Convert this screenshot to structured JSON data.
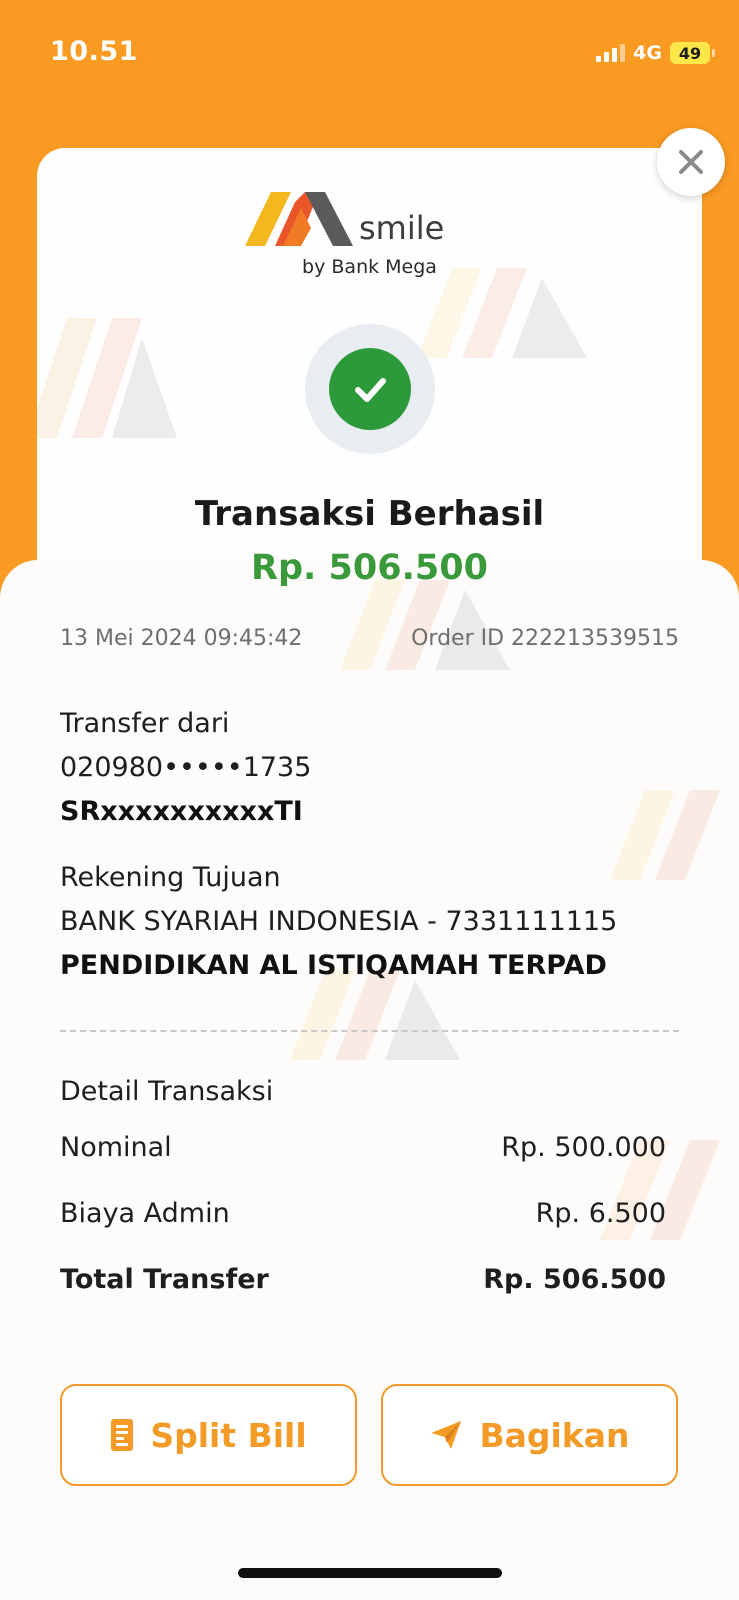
{
  "status_bar": {
    "time": "10.51",
    "network": "4G",
    "battery": "49"
  },
  "logo": {
    "name": "smile",
    "sub": "by Bank Mega"
  },
  "result": {
    "title": "Transaksi Berhasil",
    "amount": "Rp. 506.500"
  },
  "meta": {
    "date": "13 Mei 2024 09:45:42",
    "order_id": "Order ID 222213539515"
  },
  "source": {
    "label": "Transfer dari",
    "account": "020980•••••1735",
    "name": "SRxxxxxxxxxxTI"
  },
  "destination": {
    "label": "Rekening Tujuan",
    "bank_account": "BANK SYARIAH INDONESIA - 7331111115",
    "name": "PENDIDIKAN AL ISTIQAMAH TERPAD"
  },
  "details": {
    "heading": "Detail Transaksi",
    "rows": [
      {
        "label": "Nominal",
        "value": "Rp. 500.000"
      },
      {
        "label": "Biaya Admin",
        "value": "Rp. 6.500"
      },
      {
        "label": "Total Transfer",
        "value": "Rp. 506.500"
      }
    ]
  },
  "actions": {
    "split_bill": "Split Bill",
    "share": "Bagikan"
  },
  "icons": {
    "close": "close-icon",
    "success": "check-icon",
    "split_bill": "receipt-icon",
    "share": "send-icon"
  },
  "colors": {
    "brand_orange": "#f99a23",
    "success_green": "#2c9a3a",
    "amount_green": "#3a9a3b"
  }
}
